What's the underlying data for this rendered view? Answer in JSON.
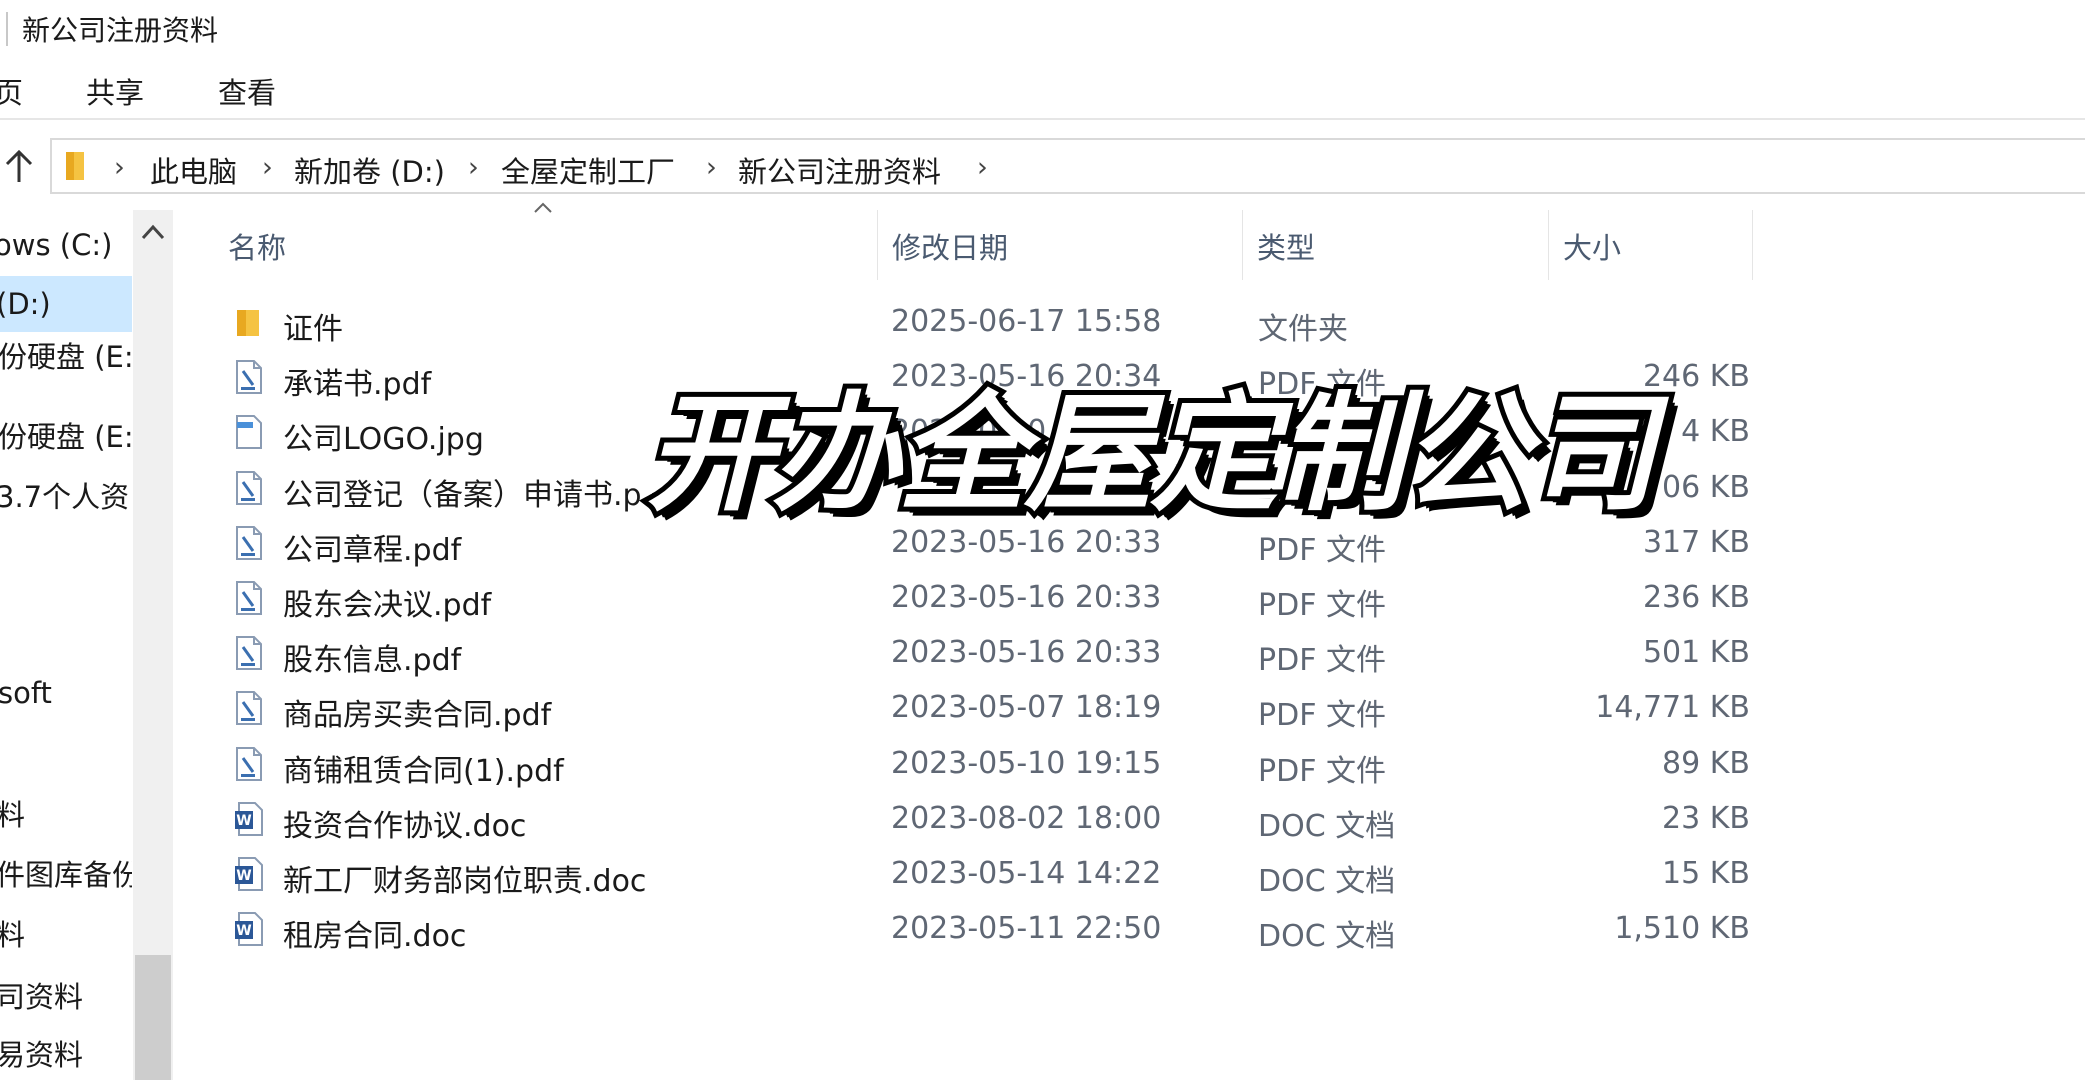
{
  "window": {
    "title": "新公司注册资料"
  },
  "ribbon": {
    "tabs": [
      "页",
      "共享",
      "查看"
    ]
  },
  "address_bar": {
    "breadcrumbs": [
      "此电脑",
      "新加卷 (D:)",
      "全屋定制工厂",
      "新公司注册资料"
    ]
  },
  "nav_pane": {
    "items": [
      {
        "label": "ows (C:)"
      },
      {
        "label": "(D:)",
        "selected": true
      },
      {
        "label": "份硬盘 (E:"
      },
      {
        "label": "份硬盘 (E:)"
      },
      {
        "label": "3.7个人资"
      },
      {
        "label": "soft"
      },
      {
        "label": "料"
      },
      {
        "label": "件图库备份"
      },
      {
        "label": "料"
      },
      {
        "label": "司资料"
      },
      {
        "label": "易资料"
      }
    ]
  },
  "columns": {
    "name": "名称",
    "date": "修改日期",
    "type": "类型",
    "size": "大小"
  },
  "files": [
    {
      "icon": "folder-icon",
      "name": "证件",
      "date": "2025-06-17 15:58",
      "type": "文件夹",
      "size": ""
    },
    {
      "icon": "pdf-file-icon",
      "name": "承诺书.pdf",
      "date": "2023-05-16 20:34",
      "type": "PDF 文件",
      "size": "246 KB"
    },
    {
      "icon": "image-file-icon",
      "name": "公司LOGO.jpg",
      "date": "2023-05-0",
      "type": "",
      "size": "4 KB"
    },
    {
      "icon": "pdf-file-icon",
      "name": "公司登记（备案）申请书.p",
      "date": "",
      "type": "",
      "size": "06 KB"
    },
    {
      "icon": "pdf-file-icon",
      "name": "公司章程.pdf",
      "date": "2023-05-16 20:33",
      "type": "PDF 文件",
      "size": "317 KB"
    },
    {
      "icon": "pdf-file-icon",
      "name": "股东会决议.pdf",
      "date": "2023-05-16 20:33",
      "type": "PDF 文件",
      "size": "236 KB"
    },
    {
      "icon": "pdf-file-icon",
      "name": "股东信息.pdf",
      "date": "2023-05-16 20:33",
      "type": "PDF 文件",
      "size": "501 KB"
    },
    {
      "icon": "pdf-file-icon",
      "name": "商品房买卖合同.pdf",
      "date": "2023-05-07 18:19",
      "type": "PDF 文件",
      "size": "14,771 KB"
    },
    {
      "icon": "pdf-file-icon",
      "name": "商铺租赁合同(1).pdf",
      "date": "2023-05-10 19:15",
      "type": "PDF 文件",
      "size": "89 KB"
    },
    {
      "icon": "word-doc-icon",
      "name": "投资合作协议.doc",
      "date": "2023-08-02 18:00",
      "type": "DOC 文档",
      "size": "23 KB"
    },
    {
      "icon": "word-doc-icon",
      "name": "新工厂财务部岗位职责.doc",
      "date": "2023-05-14 14:22",
      "type": "DOC 文档",
      "size": "15 KB"
    },
    {
      "icon": "word-doc-icon",
      "name": "租房合同.doc",
      "date": "2023-05-11 22:50",
      "type": "DOC 文档",
      "size": "1,510 KB"
    }
  ],
  "overlay": {
    "caption": "开办全屋定制公司"
  },
  "colors": {
    "selection": "#cce8ff",
    "folder": "#f5c342",
    "pdf_icon_accent": "#3b6fb0",
    "word_icon": "#2b5797",
    "overlay_fill": "#ffffff",
    "overlay_stroke": "#000000"
  }
}
